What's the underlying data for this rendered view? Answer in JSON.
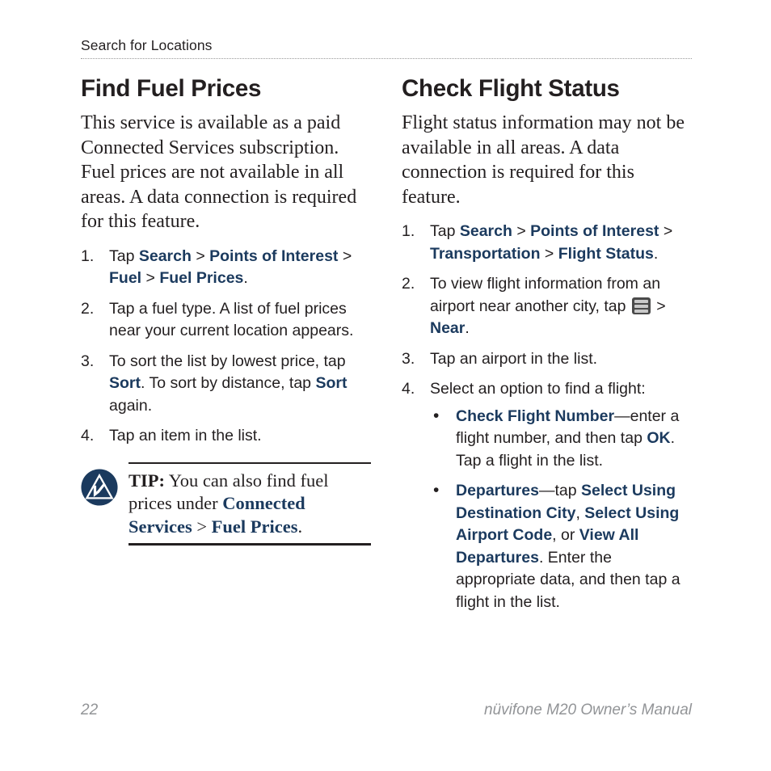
{
  "header": {
    "running_head": "Search for Locations"
  },
  "colors": {
    "ui_term_navy": "#1b3a5e",
    "body_text": "#231f20",
    "footer_gray": "#929497",
    "logo_navy": "#1b3a5e",
    "menu_icon_bg": "#4a4a4a",
    "menu_icon_bars": "#c9c9c9"
  },
  "left_column": {
    "title": "Find Fuel Prices",
    "intro": "This service is available as a paid Connected Services subscription. Fuel prices are not available in all areas. A data connection is required for this feature.",
    "steps": [
      {
        "num": "1.",
        "parts": [
          {
            "t": "Tap ",
            "s": "plain"
          },
          {
            "t": "Search",
            "s": "ui"
          },
          {
            "t": " > ",
            "s": "plain"
          },
          {
            "t": "Points of Interest",
            "s": "ui"
          },
          {
            "t": " > ",
            "s": "plain"
          },
          {
            "t": "Fuel",
            "s": "ui"
          },
          {
            "t": " > ",
            "s": "plain"
          },
          {
            "t": "Fuel Prices",
            "s": "ui"
          },
          {
            "t": ".",
            "s": "plain"
          }
        ]
      },
      {
        "num": "2.",
        "parts": [
          {
            "t": "Tap a fuel type. A list of fuel prices near your current location appears.",
            "s": "plain"
          }
        ]
      },
      {
        "num": "3.",
        "parts": [
          {
            "t": "To sort the list by lowest price, tap ",
            "s": "plain"
          },
          {
            "t": "Sort",
            "s": "ui"
          },
          {
            "t": ". To sort by distance, tap ",
            "s": "plain"
          },
          {
            "t": "Sort",
            "s": "ui"
          },
          {
            "t": " again.",
            "s": "plain"
          }
        ]
      },
      {
        "num": "4.",
        "parts": [
          {
            "t": "Tap an item in the list.",
            "s": "plain"
          }
        ]
      }
    ],
    "tip": {
      "icon_name": "garmin-logo-icon",
      "label": "TIP:",
      "parts": [
        {
          "t": " You can also find fuel prices under ",
          "s": "plain"
        },
        {
          "t": "Connected Services",
          "s": "ui"
        },
        {
          "t": " > ",
          "s": "plain"
        },
        {
          "t": "Fuel Prices",
          "s": "ui"
        },
        {
          "t": ".",
          "s": "plain"
        }
      ]
    }
  },
  "right_column": {
    "title": "Check Flight Status",
    "intro": "Flight status information may not be available in all areas. A data connection is required for this feature.",
    "steps": [
      {
        "num": "1.",
        "parts": [
          {
            "t": "Tap ",
            "s": "plain"
          },
          {
            "t": "Search",
            "s": "ui"
          },
          {
            "t": " > ",
            "s": "plain"
          },
          {
            "t": "Points of Interest",
            "s": "ui"
          },
          {
            "t": " > ",
            "s": "plain"
          },
          {
            "t": "Transportation",
            "s": "ui"
          },
          {
            "t": " > ",
            "s": "plain"
          },
          {
            "t": "Flight Status",
            "s": "ui"
          },
          {
            "t": ".",
            "s": "plain"
          }
        ]
      },
      {
        "num": "2.",
        "parts": [
          {
            "t": "To view flight information from an airport near another city, tap ",
            "s": "plain"
          },
          {
            "t": "menu-icon",
            "s": "icon"
          },
          {
            "t": " > ",
            "s": "plain"
          },
          {
            "t": "Near",
            "s": "ui"
          },
          {
            "t": ".",
            "s": "plain"
          }
        ]
      },
      {
        "num": "3.",
        "parts": [
          {
            "t": "Tap an airport in the list.",
            "s": "plain"
          }
        ]
      },
      {
        "num": "4.",
        "parts": [
          {
            "t": "Select an option to find a flight:",
            "s": "plain"
          }
        ],
        "bullets": [
          {
            "parts": [
              {
                "t": "Check Flight Number",
                "s": "ui"
              },
              {
                "t": "—enter a flight number, and then tap ",
                "s": "plain"
              },
              {
                "t": "OK",
                "s": "ui"
              },
              {
                "t": ". Tap a flight in the list.",
                "s": "plain"
              }
            ]
          },
          {
            "parts": [
              {
                "t": "Departures",
                "s": "ui"
              },
              {
                "t": "—tap ",
                "s": "plain"
              },
              {
                "t": "Select Using Destination City",
                "s": "ui"
              },
              {
                "t": ", ",
                "s": "plain"
              },
              {
                "t": "Select Using Airport Code",
                "s": "ui"
              },
              {
                "t": ", or ",
                "s": "plain"
              },
              {
                "t": "View All Departures",
                "s": "ui"
              },
              {
                "t": ". Enter the appropriate data, and then tap a flight in the list.",
                "s": "plain"
              }
            ]
          }
        ]
      }
    ]
  },
  "footer": {
    "page_number": "22",
    "manual_title": "nüvifone M20 Owner’s Manual"
  }
}
